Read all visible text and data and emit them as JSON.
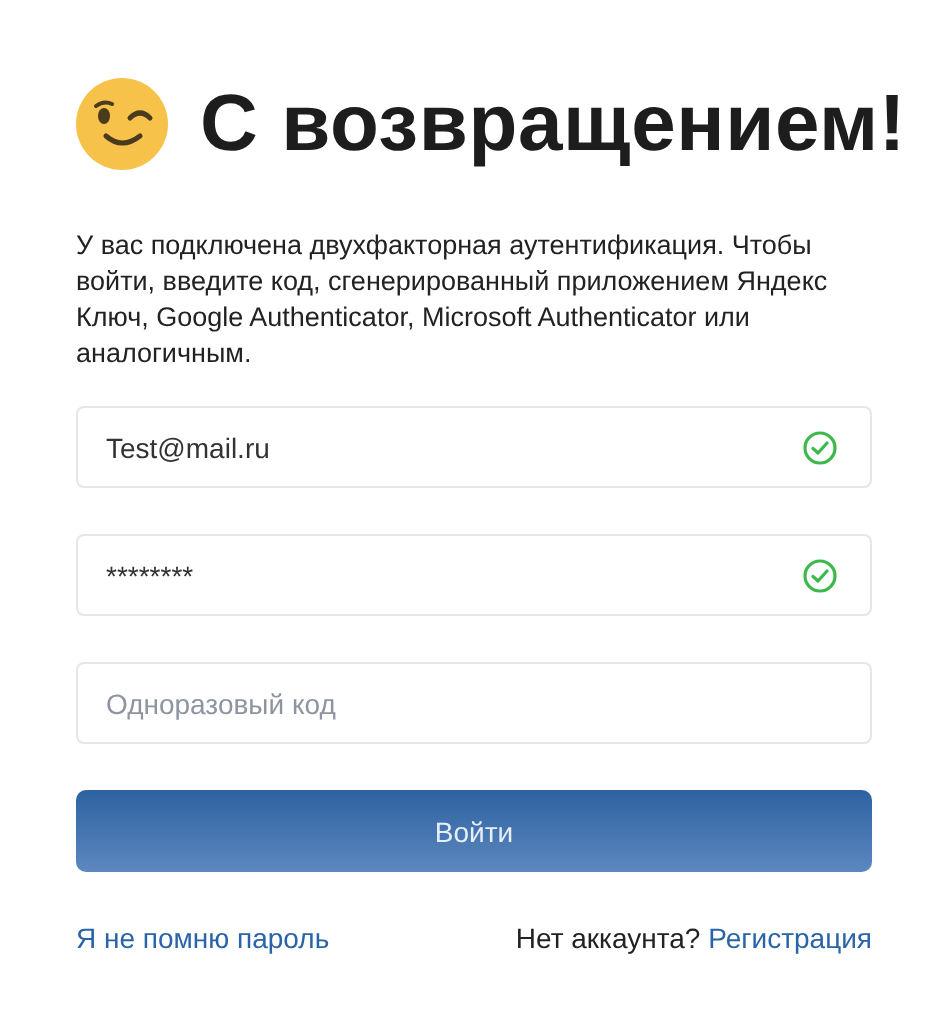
{
  "title": "С возвращением!",
  "description": "У вас подключена двухфакторная аутентификация. Чтобы войти, введите код, сгенерированный приложением Яндекс Ключ, Google Authenticator, Microsoft Authenticator или аналогичным.",
  "fields": [
    {
      "value": "Test@mail.ru",
      "valid": true
    },
    {
      "value": "********",
      "valid": true
    },
    {
      "placeholder": "Одноразовый код",
      "valid": false
    }
  ],
  "submit_button": "Войти",
  "forgot_link": "Я не помню пароль",
  "signup_prompt": "Нет аккаунта?",
  "signup_link": "Регистрация"
}
